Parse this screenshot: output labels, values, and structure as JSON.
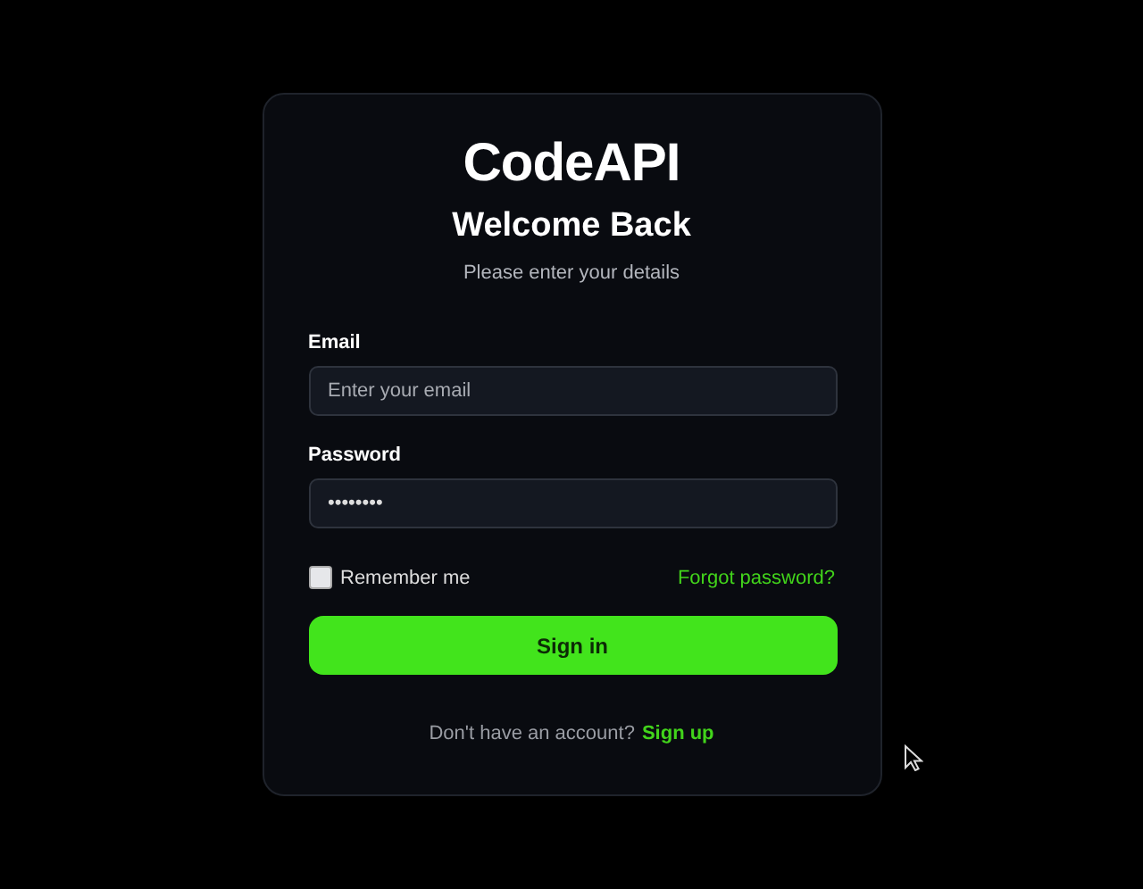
{
  "logo": "CodeAPI",
  "title": "Welcome Back",
  "subtitle": "Please enter your details",
  "fields": [
    {
      "label": "Email",
      "placeholder": "Enter your email"
    },
    {
      "label": "Password",
      "value": "••••••••"
    }
  ],
  "remember": {
    "label": "Remember me",
    "checked": false
  },
  "forgot_link": "Forgot password?",
  "submit_button": "Sign in",
  "footer": {
    "text": "Don't have an account?",
    "link": "Sign up"
  }
}
